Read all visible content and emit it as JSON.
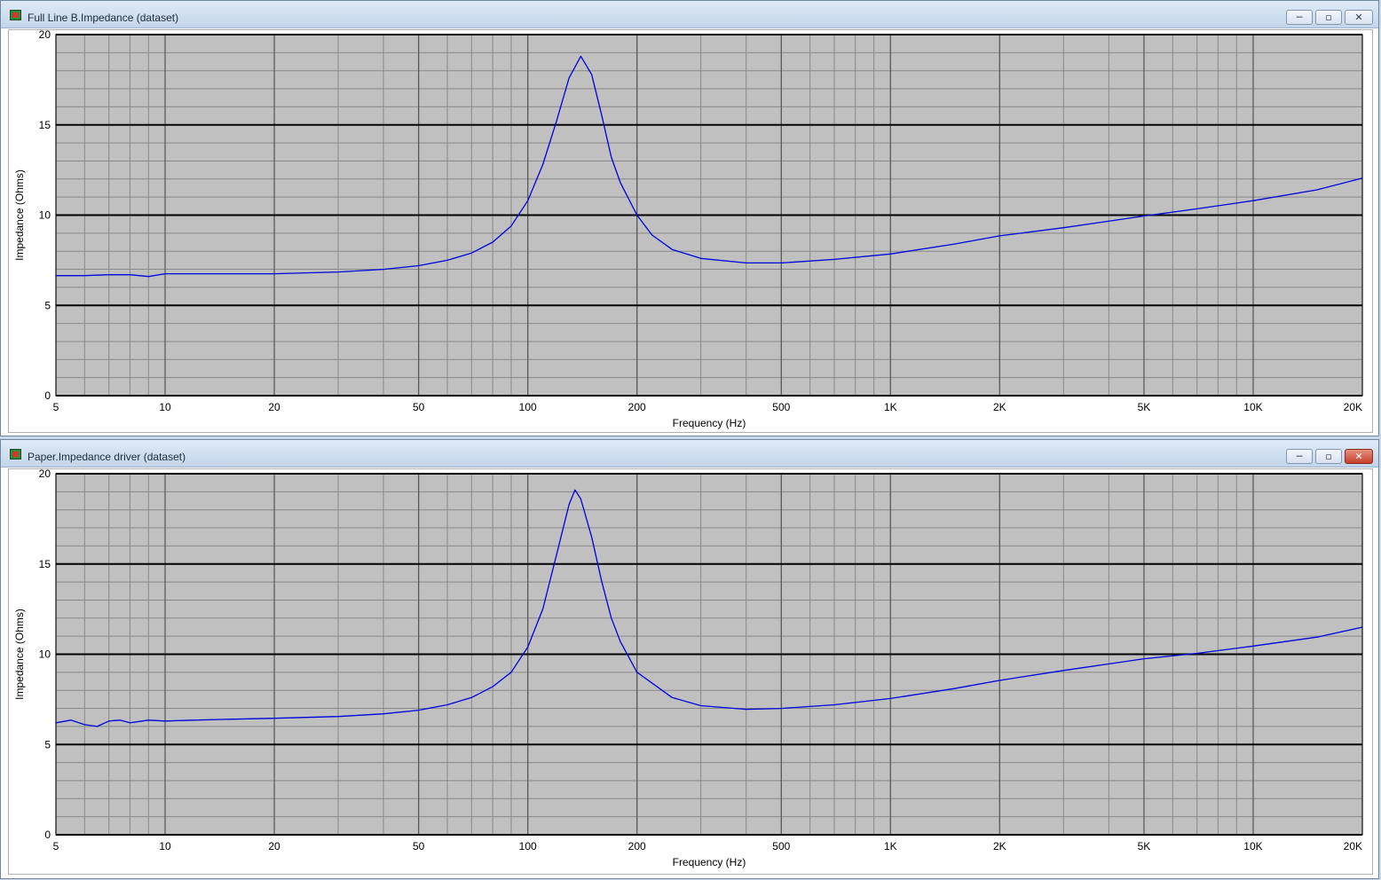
{
  "windows": [
    {
      "title": "Full Line B.Impedance (dataset)",
      "controls": {
        "minimize": "─",
        "maximize": "▫",
        "close": "✕"
      }
    },
    {
      "title": "Paper.Impedance driver (dataset)",
      "controls": {
        "minimize": "─",
        "maximize": "▫",
        "close": "✕"
      }
    }
  ],
  "colors": {
    "plot_background": "#c0c0c0",
    "major_grid": "#000000",
    "minor_grid": "#888888",
    "series": "#0000dd"
  },
  "chart_data": [
    {
      "type": "line",
      "xscale": "log",
      "xlabel": "Frequency (Hz)",
      "ylabel": "Impedance (Ohms)",
      "xlim": [
        5,
        20000
      ],
      "ylim": [
        0,
        20
      ],
      "xticks": [
        {
          "value": 5,
          "label": "5"
        },
        {
          "value": 10,
          "label": "10"
        },
        {
          "value": 20,
          "label": "20"
        },
        {
          "value": 50,
          "label": "50"
        },
        {
          "value": 100,
          "label": "100"
        },
        {
          "value": 200,
          "label": "200"
        },
        {
          "value": 500,
          "label": "500"
        },
        {
          "value": 1000,
          "label": "1K"
        },
        {
          "value": 2000,
          "label": "2K"
        },
        {
          "value": 5000,
          "label": "5K"
        },
        {
          "value": 10000,
          "label": "10K"
        },
        {
          "value": 20000,
          "label": "20K"
        }
      ],
      "yticks": [
        0,
        5,
        10,
        15,
        20
      ],
      "grid": true,
      "x": [
        5,
        6,
        7,
        8,
        9,
        10,
        12,
        15,
        20,
        30,
        40,
        50,
        60,
        70,
        80,
        90,
        100,
        110,
        120,
        130,
        140,
        150,
        160,
        170,
        180,
        200,
        220,
        250,
        300,
        400,
        500,
        700,
        1000,
        1500,
        2000,
        3000,
        5000,
        7000,
        10000,
        15000,
        20000
      ],
      "y": [
        6.65,
        6.65,
        6.7,
        6.7,
        6.6,
        6.75,
        6.75,
        6.75,
        6.75,
        6.85,
        7.0,
        7.2,
        7.5,
        7.9,
        8.5,
        9.4,
        10.8,
        12.8,
        15.2,
        17.6,
        18.8,
        17.8,
        15.5,
        13.2,
        11.8,
        10.0,
        8.9,
        8.1,
        7.6,
        7.35,
        7.35,
        7.55,
        7.85,
        8.4,
        8.85,
        9.3,
        9.95,
        10.35,
        10.8,
        11.4,
        12.05
      ]
    },
    {
      "type": "line",
      "xscale": "log",
      "xlabel": "Frequency (Hz)",
      "ylabel": "Impedance (Ohms)",
      "xlim": [
        5,
        20000
      ],
      "ylim": [
        0,
        20
      ],
      "xticks": [
        {
          "value": 5,
          "label": "5"
        },
        {
          "value": 10,
          "label": "10"
        },
        {
          "value": 20,
          "label": "20"
        },
        {
          "value": 50,
          "label": "50"
        },
        {
          "value": 100,
          "label": "100"
        },
        {
          "value": 200,
          "label": "200"
        },
        {
          "value": 500,
          "label": "500"
        },
        {
          "value": 1000,
          "label": "1K"
        },
        {
          "value": 2000,
          "label": "2K"
        },
        {
          "value": 5000,
          "label": "5K"
        },
        {
          "value": 10000,
          "label": "10K"
        },
        {
          "value": 20000,
          "label": "20K"
        }
      ],
      "yticks": [
        0,
        5,
        10,
        15,
        20
      ],
      "grid": true,
      "x": [
        5,
        5.5,
        6,
        6.5,
        7,
        7.5,
        8,
        9,
        10,
        12,
        15,
        20,
        30,
        40,
        50,
        60,
        70,
        80,
        90,
        100,
        110,
        120,
        130,
        135,
        140,
        150,
        160,
        170,
        180,
        200,
        250,
        300,
        400,
        500,
        700,
        1000,
        1500,
        2000,
        3000,
        5000,
        7000,
        10000,
        15000,
        20000
      ],
      "y": [
        6.2,
        6.35,
        6.1,
        6.0,
        6.3,
        6.35,
        6.2,
        6.35,
        6.3,
        6.35,
        6.4,
        6.45,
        6.55,
        6.7,
        6.9,
        7.2,
        7.6,
        8.2,
        9.0,
        10.4,
        12.5,
        15.5,
        18.3,
        19.1,
        18.6,
        16.5,
        14.0,
        12.0,
        10.7,
        9.0,
        7.6,
        7.15,
        6.95,
        7.0,
        7.2,
        7.55,
        8.1,
        8.55,
        9.1,
        9.75,
        10.05,
        10.45,
        10.95,
        11.5
      ]
    }
  ]
}
